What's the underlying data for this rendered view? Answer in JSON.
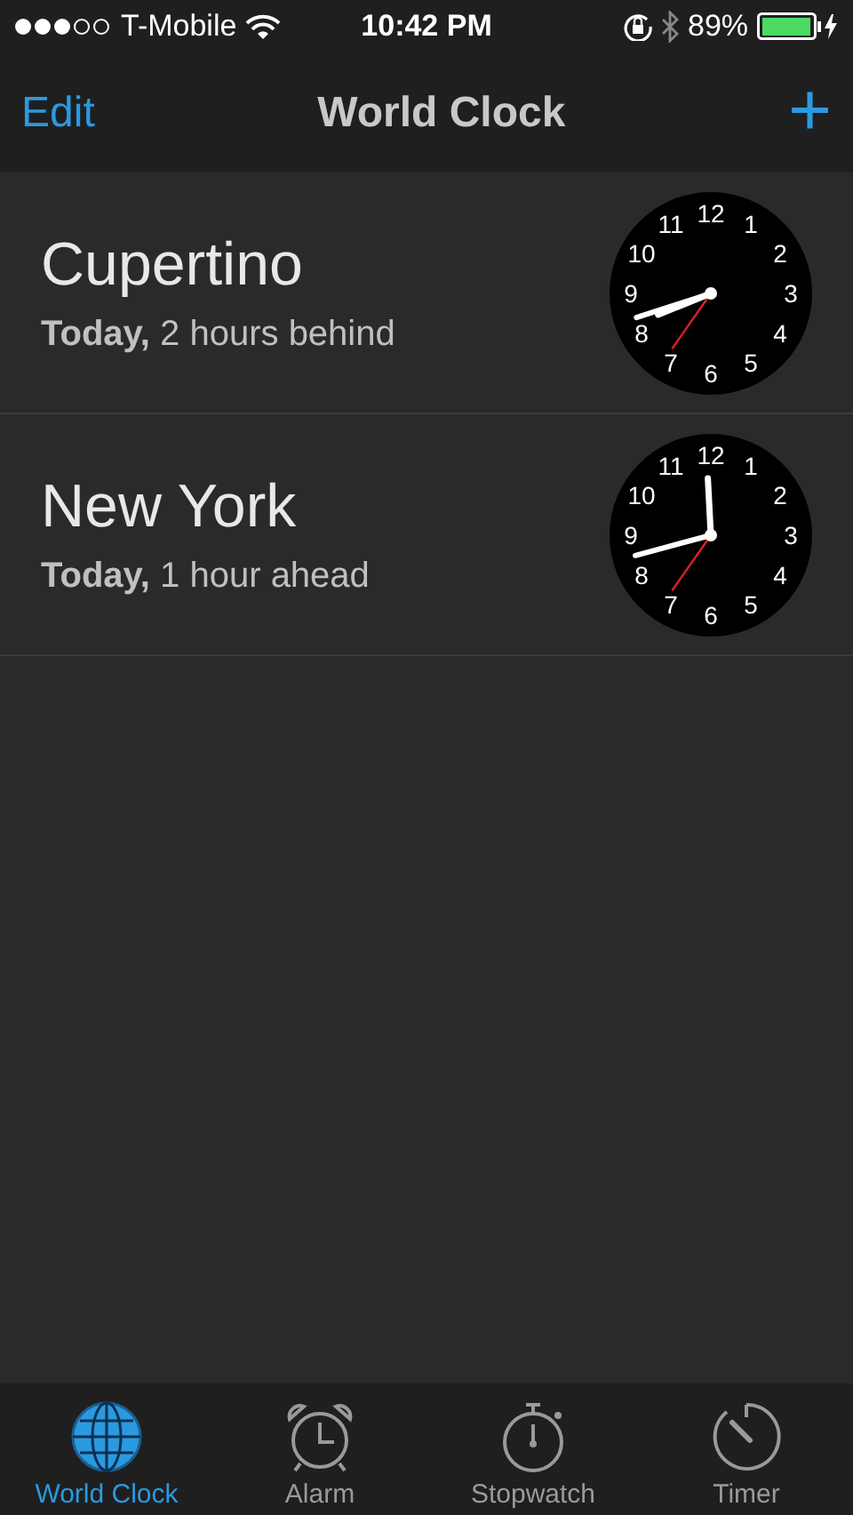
{
  "status_bar": {
    "carrier": "T-Mobile",
    "time": "10:42 PM",
    "battery": "89%"
  },
  "nav_bar": {
    "left": "Edit",
    "title": "World Clock",
    "right": "+"
  },
  "cities": [
    {
      "name": "Cupertino",
      "day": "Today,",
      "offset": "2 hours behind",
      "dial": [
        "12",
        "11",
        "1",
        "10",
        "2",
        "9",
        "3",
        "8",
        "4",
        "7",
        "5",
        "6"
      ]
    },
    {
      "name": "New York",
      "day": "Today,",
      "offset": "1 hour ahead",
      "dial": [
        "12",
        "11",
        "1",
        "10",
        "2",
        "9",
        "3",
        "8",
        "4",
        "7",
        "5",
        "6"
      ]
    }
  ],
  "tabs": [
    {
      "kind": "globe",
      "label": "World Clock",
      "selected": true
    },
    {
      "kind": "alarm",
      "label": "Alarm",
      "selected": false
    },
    {
      "kind": "stopwatch",
      "label": "Stopwatch",
      "selected": false
    },
    {
      "kind": "timer",
      "label": "Timer",
      "selected": false
    }
  ]
}
